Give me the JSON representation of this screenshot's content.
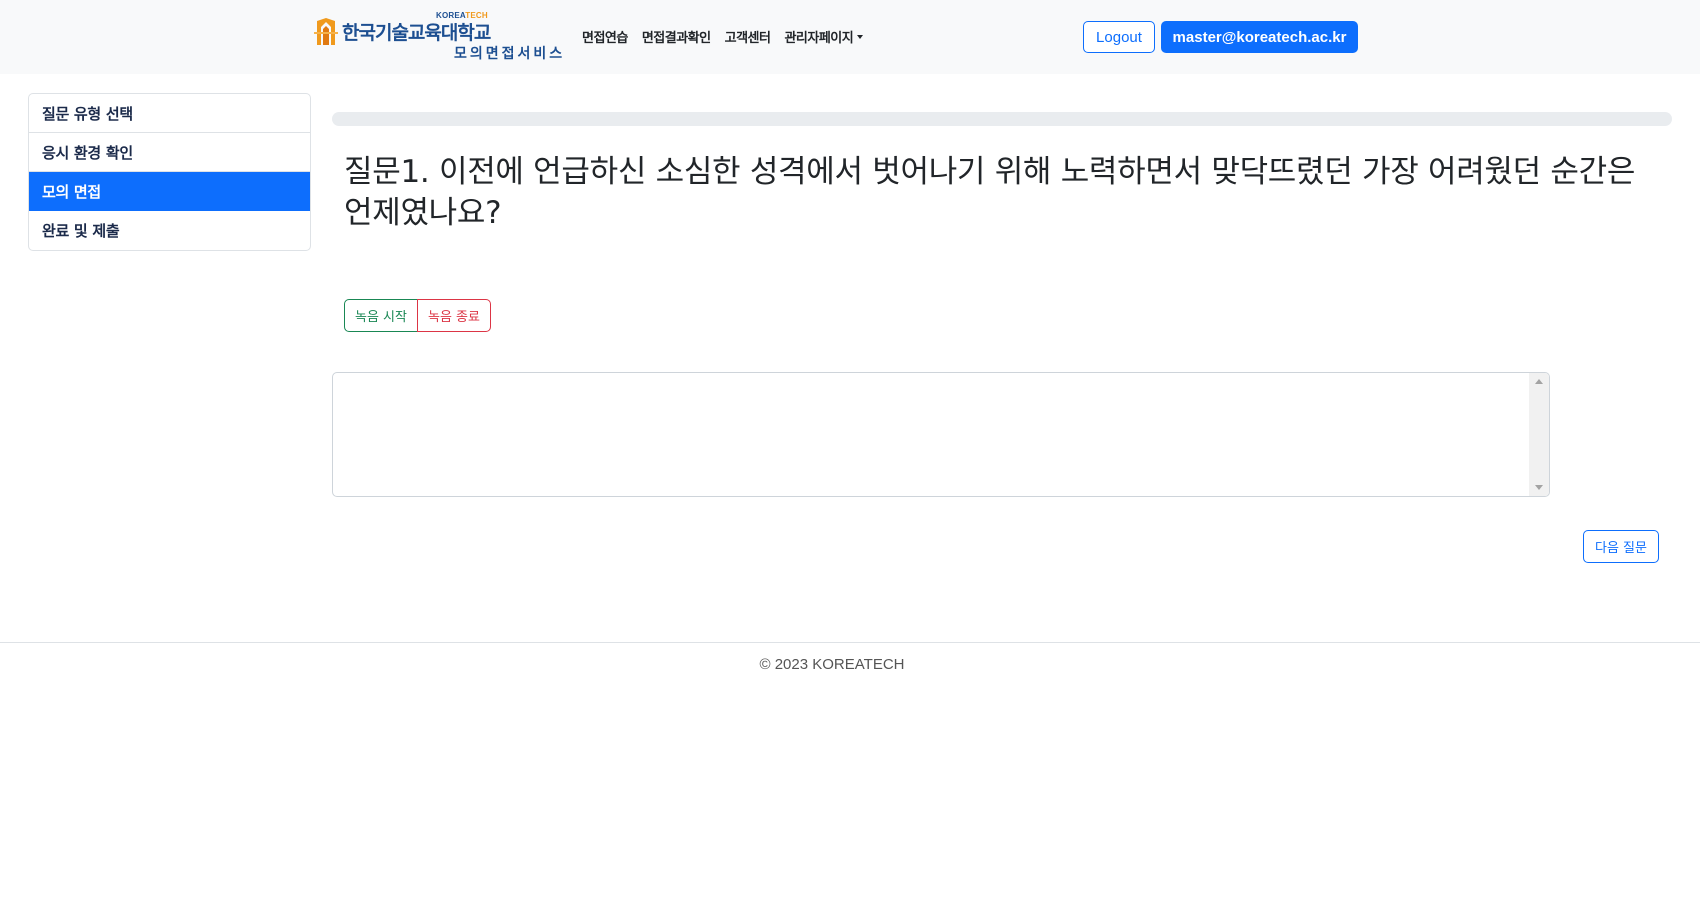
{
  "header": {
    "logo": {
      "tag_prefix": "KOREA",
      "tag_suffix": "TECH",
      "name": "한국기술교육대학교",
      "subtitle": "모의면접서비스",
      "icon": "university-emblem-icon"
    },
    "nav": [
      {
        "label": "면접연습"
      },
      {
        "label": "면접결과확인"
      },
      {
        "label": "고객센터"
      },
      {
        "label": "관리자페이지",
        "dropdown": true
      }
    ],
    "logout_label": "Logout",
    "user_email": "master@koreatech.ac.kr"
  },
  "sidebar": {
    "items": [
      {
        "label": "질문 유형 선택",
        "active": false
      },
      {
        "label": "응시 환경 확인",
        "active": false
      },
      {
        "label": "모의 면접",
        "active": true
      },
      {
        "label": "완료 및 제출",
        "active": false
      }
    ]
  },
  "main": {
    "progress_percent": 0,
    "question": "질문1. 이전에 언급하신 소심한 성격에서 벗어나기 위해 노력하면서 맞닥뜨렸던 가장 어려웠던 순간은 언제였나요?",
    "record_start_label": "녹음 시작",
    "record_stop_label": "녹음 종료",
    "answer_value": "",
    "answer_placeholder": "",
    "next_label": "다음 질문"
  },
  "footer": {
    "copyright": "© 2023 KOREATECH"
  },
  "colors": {
    "primary": "#0d6efd",
    "success": "#198754",
    "danger": "#dc3545",
    "navbar_bg": "#f8f9fa",
    "brand_navy": "#1d4f91",
    "brand_orange": "#f09a1d"
  }
}
